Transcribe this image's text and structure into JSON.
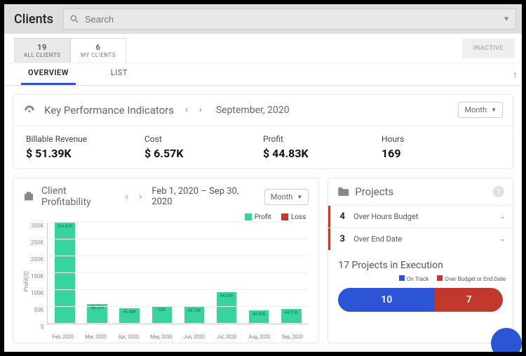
{
  "header": {
    "title": "Clients",
    "search_placeholder": "Search"
  },
  "client_tabs": {
    "all": {
      "count": "19",
      "label": "ALL CLIENTS"
    },
    "my": {
      "count": "6",
      "label": "MY CLIENTS"
    },
    "inactive": "INACTIVE"
  },
  "view_tabs": {
    "overview": "OVERVIEW",
    "list": "LIST"
  },
  "kpi": {
    "title": "Key Performance Indicators",
    "period": "September, 2020",
    "granularity": "Month",
    "items": [
      {
        "label": "Billable Revenue",
        "value": "$ 51.39K"
      },
      {
        "label": "Cost",
        "value": "$ 6.57K"
      },
      {
        "label": "Profit",
        "value": "$ 44.83K"
      },
      {
        "label": "Hours",
        "value": "169"
      }
    ]
  },
  "chart": {
    "title": "Client Profitability",
    "range": "Feb 1, 2020 – Sep 30, 2020",
    "granularity": "Month",
    "legend": {
      "profit": "Profit",
      "loss": "Loss"
    },
    "colors": {
      "profit": "#38d39f",
      "loss": "#c0392b"
    },
    "ylabel": "Profit($)",
    "yticks": [
      "300K",
      "250K",
      "200K",
      "150K",
      "100K",
      "50K",
      "0"
    ]
  },
  "chart_data": {
    "type": "bar",
    "title": "Client Profitability",
    "xlabel": "",
    "ylabel": "Profit($)",
    "ylim": [
      0,
      300000
    ],
    "categories": [
      "Feb, 2020",
      "Mar, 2020",
      "Apr, 2020",
      "May, 2020",
      "Jun, 2020",
      "Jul, 2020",
      "Aug, 2020",
      "Sep, 2020"
    ],
    "series": [
      {
        "name": "Profit",
        "values": [
          314870,
          58229,
          45480,
          52000,
          49760,
          94299,
          40598,
          44510
        ]
      },
      {
        "name": "Loss",
        "values": [
          0,
          0,
          0,
          0,
          0,
          0,
          0,
          0
        ]
      }
    ],
    "data_labels": [
      "314.87K",
      "58.229",
      "45.48K",
      "52K",
      "49.76K",
      "94.299",
      "40.598",
      "44.51K"
    ]
  },
  "projects": {
    "title": "Projects",
    "alerts": [
      {
        "count": "4",
        "label": "Over Hours Budget"
      },
      {
        "count": "3",
        "label": "Over End Date"
      }
    ],
    "exec_title": "17 Projects in Execution",
    "exec_legend": {
      "ok": "On Track",
      "bad": "Over Budget or End Date"
    },
    "exec_counts": {
      "ok": "10",
      "bad": "7"
    },
    "colors": {
      "ok": "#2b55d4",
      "bad": "#c0392b"
    }
  }
}
